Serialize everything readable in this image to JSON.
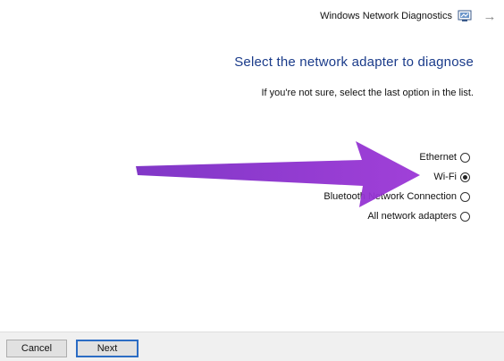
{
  "window": {
    "title": "Windows Network Diagnostics",
    "back_icon": "back-arrow-icon",
    "app_icon": "network-diagnostics-icon"
  },
  "main": {
    "heading": "Select the network adapter to diagnose",
    "instruction": "If you're not sure, select the last option in the list.",
    "options": [
      {
        "label": "Ethernet",
        "selected": false
      },
      {
        "label": "Wi-Fi",
        "selected": true
      },
      {
        "label": "Bluetooth Network Connection",
        "selected": false
      },
      {
        "label": "All network adapters",
        "selected": false
      }
    ],
    "annotation_color": "#8b2fc9"
  },
  "footer": {
    "next_label": "Next",
    "cancel_label": "Cancel"
  }
}
